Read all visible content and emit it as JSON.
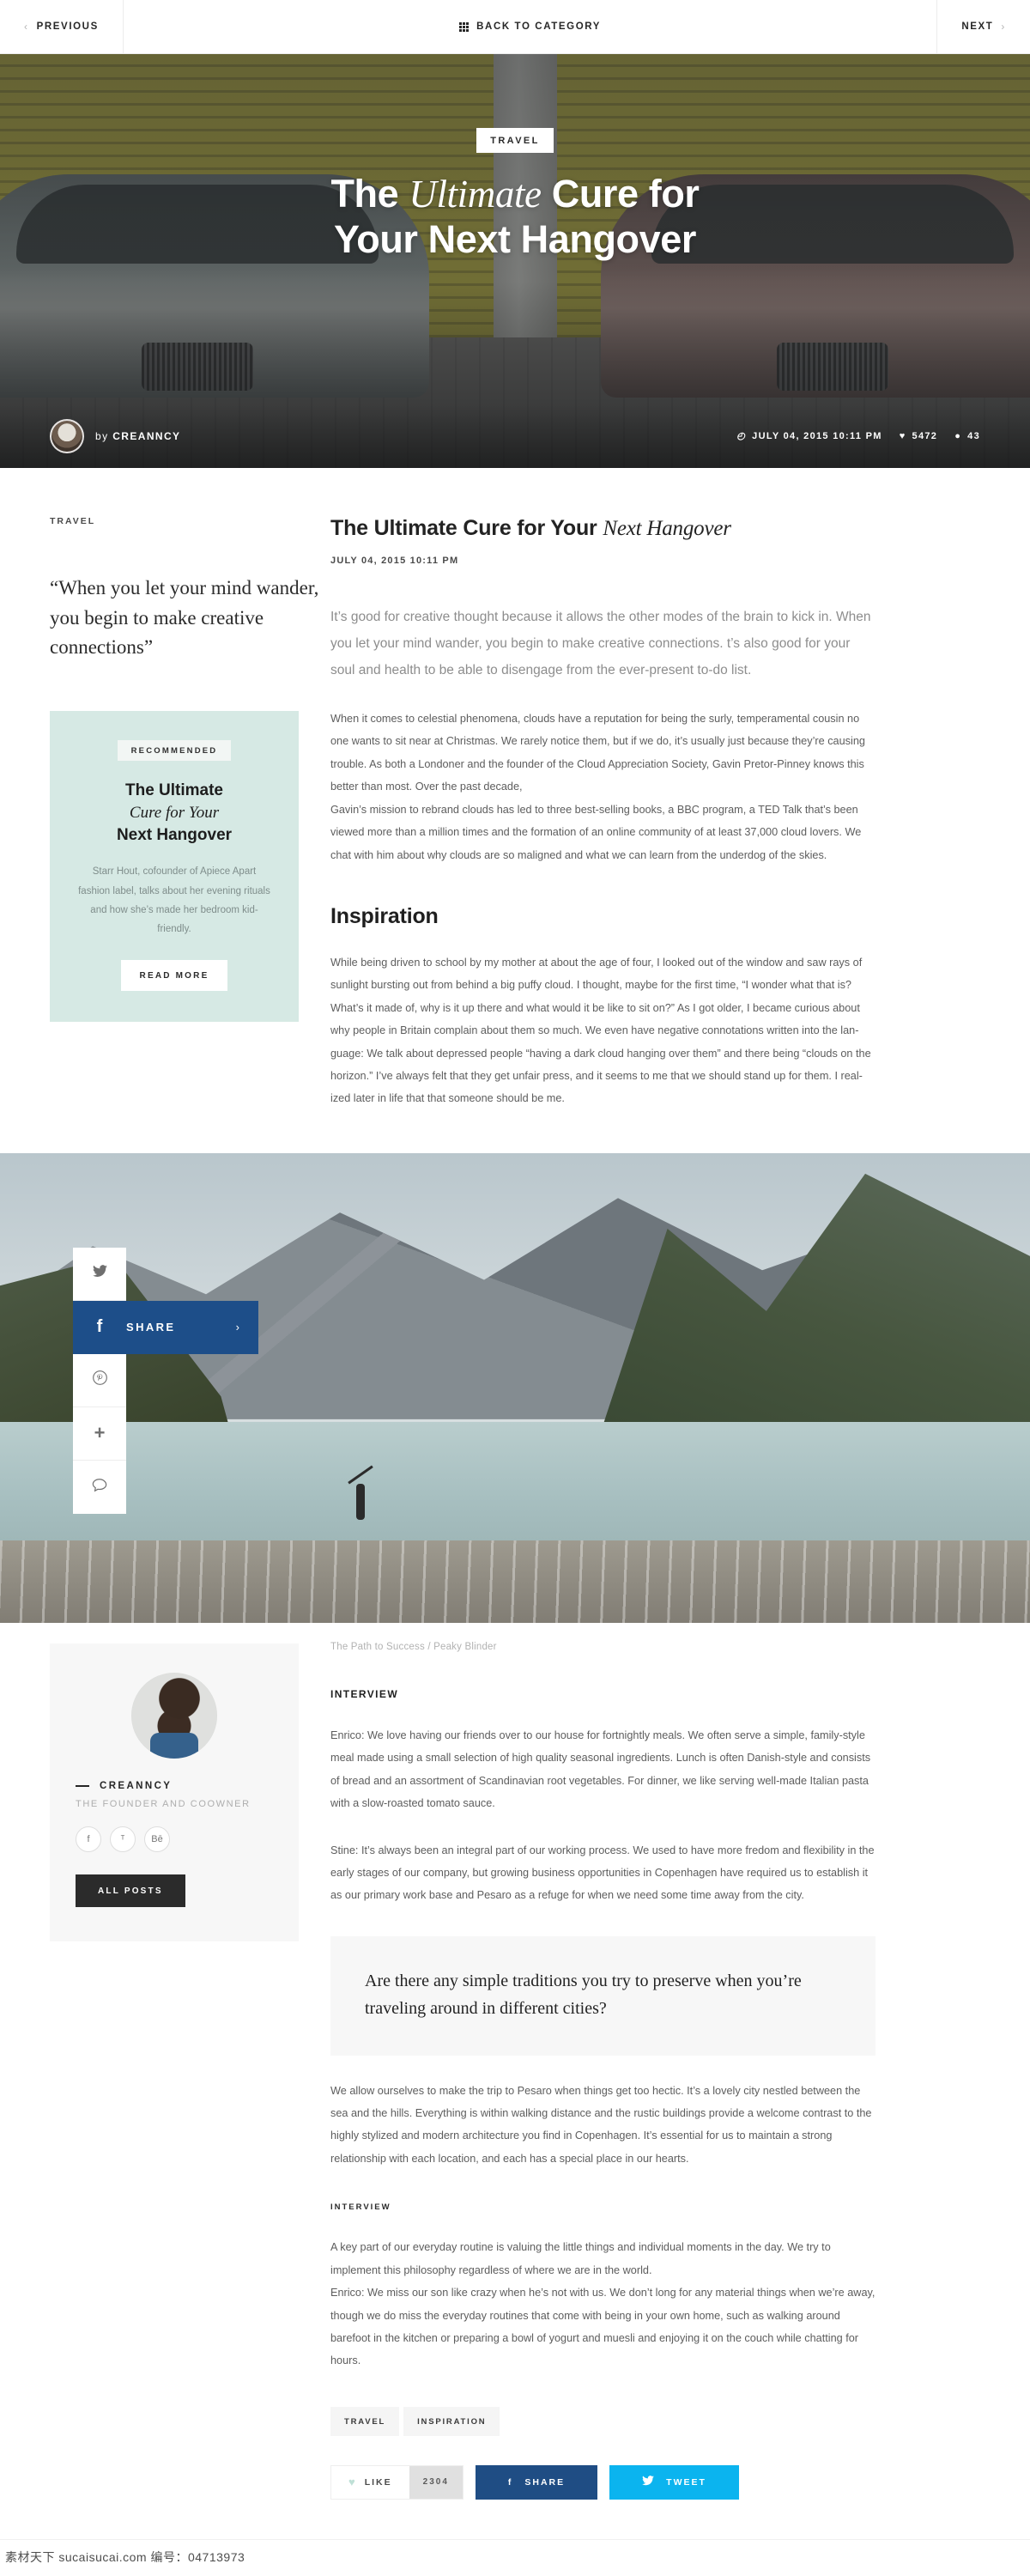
{
  "topnav": {
    "previous": "PREVIOUS",
    "back_to_category": "BACK TO CATEGORY",
    "next": "NEXT",
    "prev_chevron": "‹",
    "next_chevron": "›"
  },
  "hero": {
    "category_badge": "TRAVEL",
    "title_part1": "The ",
    "title_italic": "Ultimate",
    "title_part2": " Cure for",
    "title_line2": "Your Next Hangover",
    "byline_prefix": "by ",
    "author": "CREANNCY",
    "date": "JULY 04, 2015 10:11 PM",
    "likes": "5472",
    "comments": "43",
    "clock_icon": "◴",
    "heart_icon": "♥",
    "comment_icon": "●"
  },
  "article": {
    "kicker": "TRAVEL",
    "title_part1": "The Ultimate Cure for Your ",
    "title_italic": "Next Hangover",
    "date": "JULY 04, 2015 10:11 PM",
    "pullquote": "“When you let your mind wander, you begin to make creative connec­tions”",
    "lead": "It’s good for creative thought because it allows the other modes of the brain to kick in. When you let your mind wander, you begin to make creative con­nections. t’s also good for your soul and health to be able to disengage from the ever-present to-do list.",
    "paragraph1": "When it comes to celestial phenomena, clouds have a reputation for being the surly, temperamental cousin no one wants to sit near at Christmas. We rarely notice them, but if we do, it’s usually just because they’re causing trouble. As both a Londoner and the founder of the Cloud Appreciation Society, Gavin Pretor-Pinney knows this better than most. Over the past decade,",
    "paragraph2": "Gavin’s mission to rebrand clouds has led to three best-selling books, a BBC program, a TED Talk that’s been viewed more than a million times and the formation of an online community of at least 37,000 cloud lovers. We chat with him about why clouds are so maligned and  what we can learn from the underdog of the skies.",
    "heading_inspiration": "Inspiration",
    "paragraph3": "While being driven to school by my mother at about the age of four, I looked out of the window and saw rays of sunlight bursting out from behind a big puffy cloud. I thought, maybe for the first time, “I wonder what that is? What’s it made of, why is it up there and what would it be like to sit on?” As I got older, I became curious about why people in Britain complain about them so much. We even have negative connotations written into the lan­guage: We talk about depressed people “having a dark cloud hanging over them” and there being “clouds on the horizon.” I’ve always felt that they get unfair press, and it seems to me that we should stand up for them. I real­ized later in life that that someone should be me."
  },
  "recommended": {
    "tag": "RECOMMENDED",
    "title_line1": "The Ultimate",
    "title_italic": "Cure for Your",
    "title_line3": "Next Hangover",
    "description": "Starr Hout, cofounder of Apiece Apart fashion label, talks about her evening rituals and how she’s made her bedroom kid-friendly.",
    "button": "READ MORE"
  },
  "share_rail": {
    "twitter_icon": "ᵀ",
    "facebook_icon": "f",
    "pinterest_icon": "Ⓟ",
    "plus_icon": "＋",
    "comment_icon": "○",
    "share_label": "SHARE",
    "share_arrow": "›"
  },
  "caption": {
    "title": "The Path to Success",
    "separator": " / ",
    "subtitle": "Peaky Blinder"
  },
  "author_card": {
    "name": "CREANNCY",
    "role": "THE FOUNDER AND COOWNER",
    "social": [
      "f",
      "ᵀ",
      "Bē"
    ],
    "button": "ALL POSTS"
  },
  "interview": {
    "label": "INTERVIEW",
    "paragraph1": "Enrico: We love having our friends over to our house for fortnightly meals. We often serve a simple, family-style meal made using a small selection of high quality seasonal ingredients. Lunch is often Danish-style and consists of bread and an assortment of Scandinavian root vegetables. For dinner, we like serving well-made Italian pasta with a slow-roasted tomato sauce.",
    "paragraph2": "Stine: It’s always been an integral part of our working process. We used to have more fredom and flexibility in the early stages of our company, but growing business opportunities in Copenhagen have required us to establish it as our primary work base and Pesaro as a refuge for when we need some time away from the city.",
    "question": "Are there any simple traditions you try to preserve when you’re traveling around in different cities?",
    "paragraph3": "We allow ourselves to make the trip to Pesaro when things get too hectic. It’s a lovely city nestled between the sea and the hills. Everything is within walking distance and the rustic buildings provide a welcome contrast to the highly stylized and modern architecture you find in Copenhagen. It’s essen­tial for us to maintain a strong relationship with each location, and each has a special place in our hearts.",
    "label2": "INTERVIEW",
    "paragraph4": "A key part of our everyday routine is valuing the little things and individual moments in the day. We try to implement this philosophy regardless of where we are in the world.",
    "paragraph5": "Enrico: We miss our son like crazy when he’s not with us. We don’t long for any material things when we’re away, though we do miss the everyday routines that come with being in your own home, such as walking around barefoot in the kitchen or preparing a bowl of yogurt and muesli and enjoying it on the couch while chatting for hours."
  },
  "footer_actions": {
    "tags": [
      "TRAVEL",
      "INSPIRATION"
    ],
    "like_label": "LIKE",
    "like_count": "2304",
    "like_icon": "♥",
    "share_label": "SHARE",
    "share_icon": "f",
    "tweet_label": "TWEET",
    "tweet_icon": "ᵀ"
  },
  "watermark": {
    "text": "素材天下 sucaisucai.com  编号：04713973"
  },
  "colors": {
    "facebook": "#1f4d84",
    "twitter": "#0bb4ef",
    "recommended_bg": "#d6e9e4",
    "dark": "#2b2b2b"
  }
}
